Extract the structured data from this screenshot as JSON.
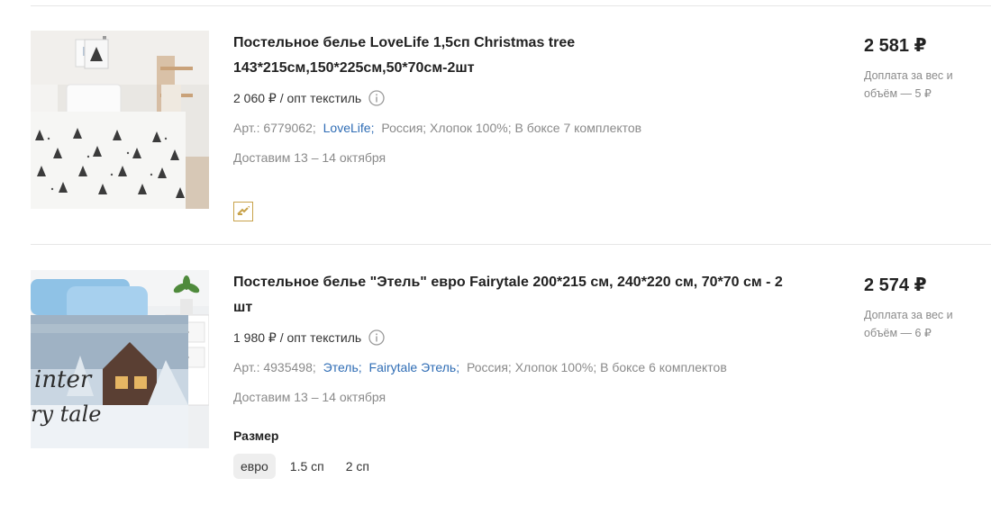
{
  "products": [
    {
      "title": "Постельное белье LoveLife 1,5сп Christmas tree 143*215см,150*225см,50*70см-2шт",
      "price": "2 581 ₽",
      "surcharge": "Доплата за вес и объём — 5 ₽",
      "opt_price": "2 060 ₽ / опт текстиль",
      "article_prefix": "Арт.: 6779062;",
      "brand_links": [
        "LoveLife;"
      ],
      "attributes": "Россия; Хлопок 100%; В боксе 7 комплектов",
      "delivery": "Доставим 13 – 14 октября",
      "badge_icon": "fast-delivery-icon"
    },
    {
      "title": "Постельное белье \"Этель\" евро Fairytale 200*215 см, 240*220 см, 70*70 см - 2 шт",
      "price": "2 574 ₽",
      "surcharge": "Доплата за вес и объём — 6 ₽",
      "opt_price": "1 980 ₽ / опт текстиль",
      "article_prefix": "Арт.: 4935498;",
      "brand_links": [
        "Этель;",
        "Fairytale Этель;"
      ],
      "attributes": "Россия; Хлопок 100%; В боксе 6 комплектов",
      "delivery": "Доставим 13 – 14 октября",
      "size_label": "Размер",
      "sizes": [
        "евро",
        "1.5 сп",
        "2 сп"
      ],
      "selected_size": "евро"
    }
  ],
  "colors": {
    "link": "#2f6db5",
    "muted": "#8a8a8a",
    "badge_border": "#c8a24a"
  }
}
